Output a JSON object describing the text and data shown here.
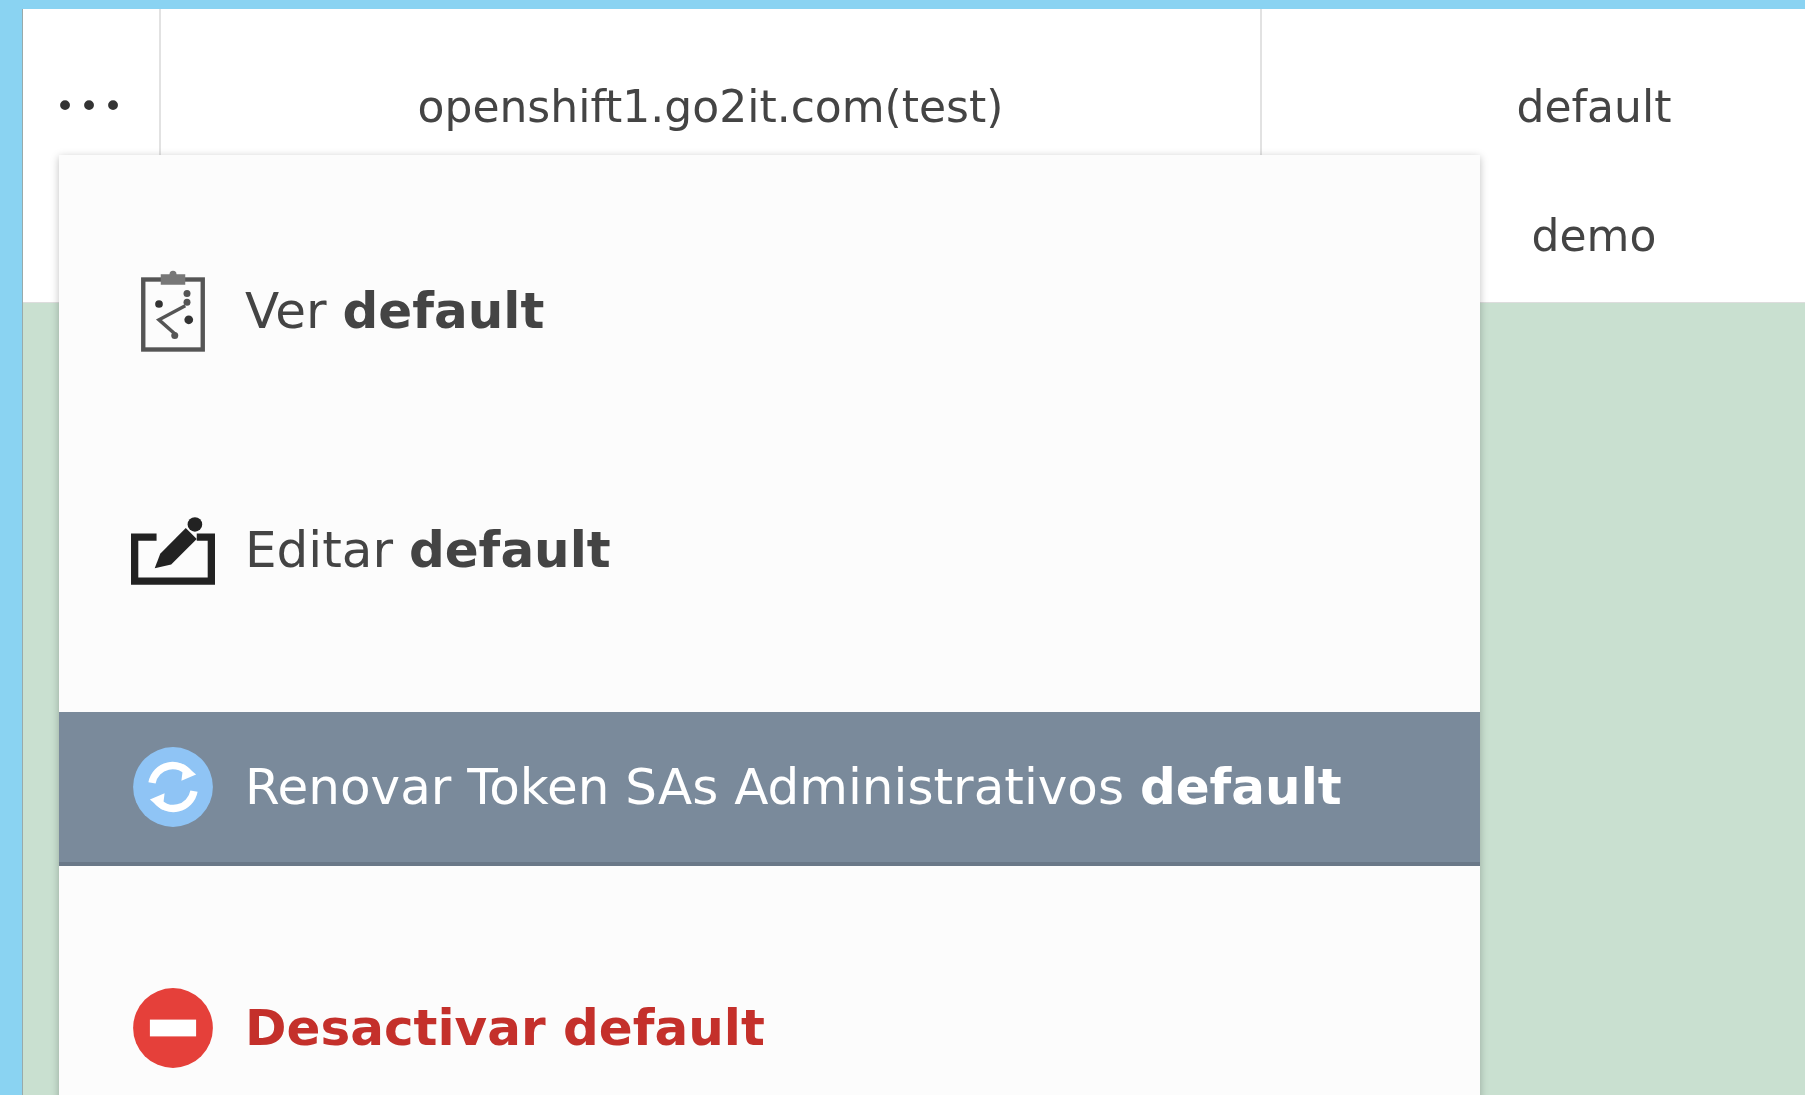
{
  "table": {
    "rows": [
      {
        "menu_button": "•••",
        "cells": [
          "openshift1.go2it.com(test)",
          "default"
        ]
      },
      {
        "cells": [
          "",
          "demo"
        ]
      }
    ]
  },
  "context_menu": {
    "items": [
      {
        "kind": "view",
        "label": "Ver **default**",
        "selected": false
      },
      {
        "kind": "edit",
        "label": "Editar **default**",
        "selected": false
      },
      {
        "kind": "renew",
        "label": "Renovar Token SAs Administrativos **default**",
        "selected": true
      },
      {
        "kind": "deactivate",
        "label": "Desactivar default",
        "selected": false
      }
    ]
  }
}
